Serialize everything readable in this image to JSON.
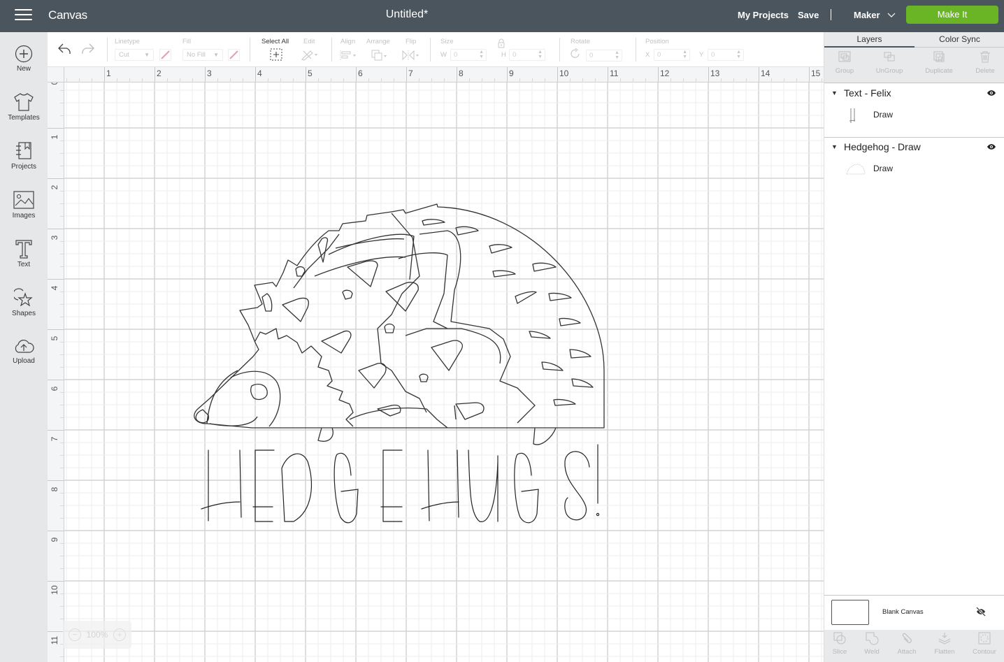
{
  "topbar": {
    "app_title": "Canvas",
    "doc_title": "Untitled*",
    "my_projects": "My Projects",
    "save": "Save",
    "machine": "Maker",
    "make_it": "Make It",
    "make_it_color": "#6ab526"
  },
  "leftbar": {
    "items": [
      {
        "label": "New",
        "icon": "plus-circle-icon"
      },
      {
        "label": "Templates",
        "icon": "tshirt-icon"
      },
      {
        "label": "Projects",
        "icon": "notebook-icon"
      },
      {
        "label": "Images",
        "icon": "image-icon"
      },
      {
        "label": "Text",
        "icon": "text-t-icon"
      },
      {
        "label": "Shapes",
        "icon": "shapes-icon"
      },
      {
        "label": "Upload",
        "icon": "cloud-upload-icon"
      }
    ]
  },
  "toolbar": {
    "linetype_label": "Linetype",
    "linetype_value": "Cut",
    "fill_label": "Fill",
    "fill_value": "No Fill",
    "select_all": "Select All",
    "edit": "Edit",
    "align": "Align",
    "arrange": "Arrange",
    "flip": "Flip",
    "size": "Size",
    "w_label": "W",
    "w_value": "0",
    "h_label": "H",
    "h_value": "0",
    "rotate": "Rotate",
    "rotate_value": "0",
    "position": "Position",
    "x_label": "X",
    "x_value": "0",
    "y_label": "Y",
    "y_value": "0"
  },
  "ruler": {
    "top": [
      "1",
      "2",
      "3",
      "4",
      "5",
      "6",
      "7",
      "8",
      "9",
      "10",
      "11",
      "12",
      "13",
      "14",
      "15"
    ],
    "left": [
      "0",
      "1",
      "2",
      "3",
      "4",
      "5",
      "6",
      "7",
      "8",
      "9",
      "10",
      "11"
    ]
  },
  "zoom": {
    "value": "100%",
    "minus": "−",
    "plus": "+"
  },
  "rightpanel": {
    "tabs": [
      {
        "label": "Layers",
        "active": true
      },
      {
        "label": "Color Sync",
        "active": false
      }
    ],
    "actions": [
      "Group",
      "UnGroup",
      "Duplicate",
      "Delete"
    ],
    "layers": [
      {
        "title": "Text - Felix",
        "child": "Draw",
        "visible": true
      },
      {
        "title": "Hedgehog - Draw",
        "child": "Draw",
        "visible": true
      }
    ],
    "blank_canvas": "Blank Canvas",
    "bottom_actions": [
      "Slice",
      "Weld",
      "Attach",
      "Flatten",
      "Contour"
    ]
  },
  "design": {
    "text": "HEDGEHUGS!"
  }
}
